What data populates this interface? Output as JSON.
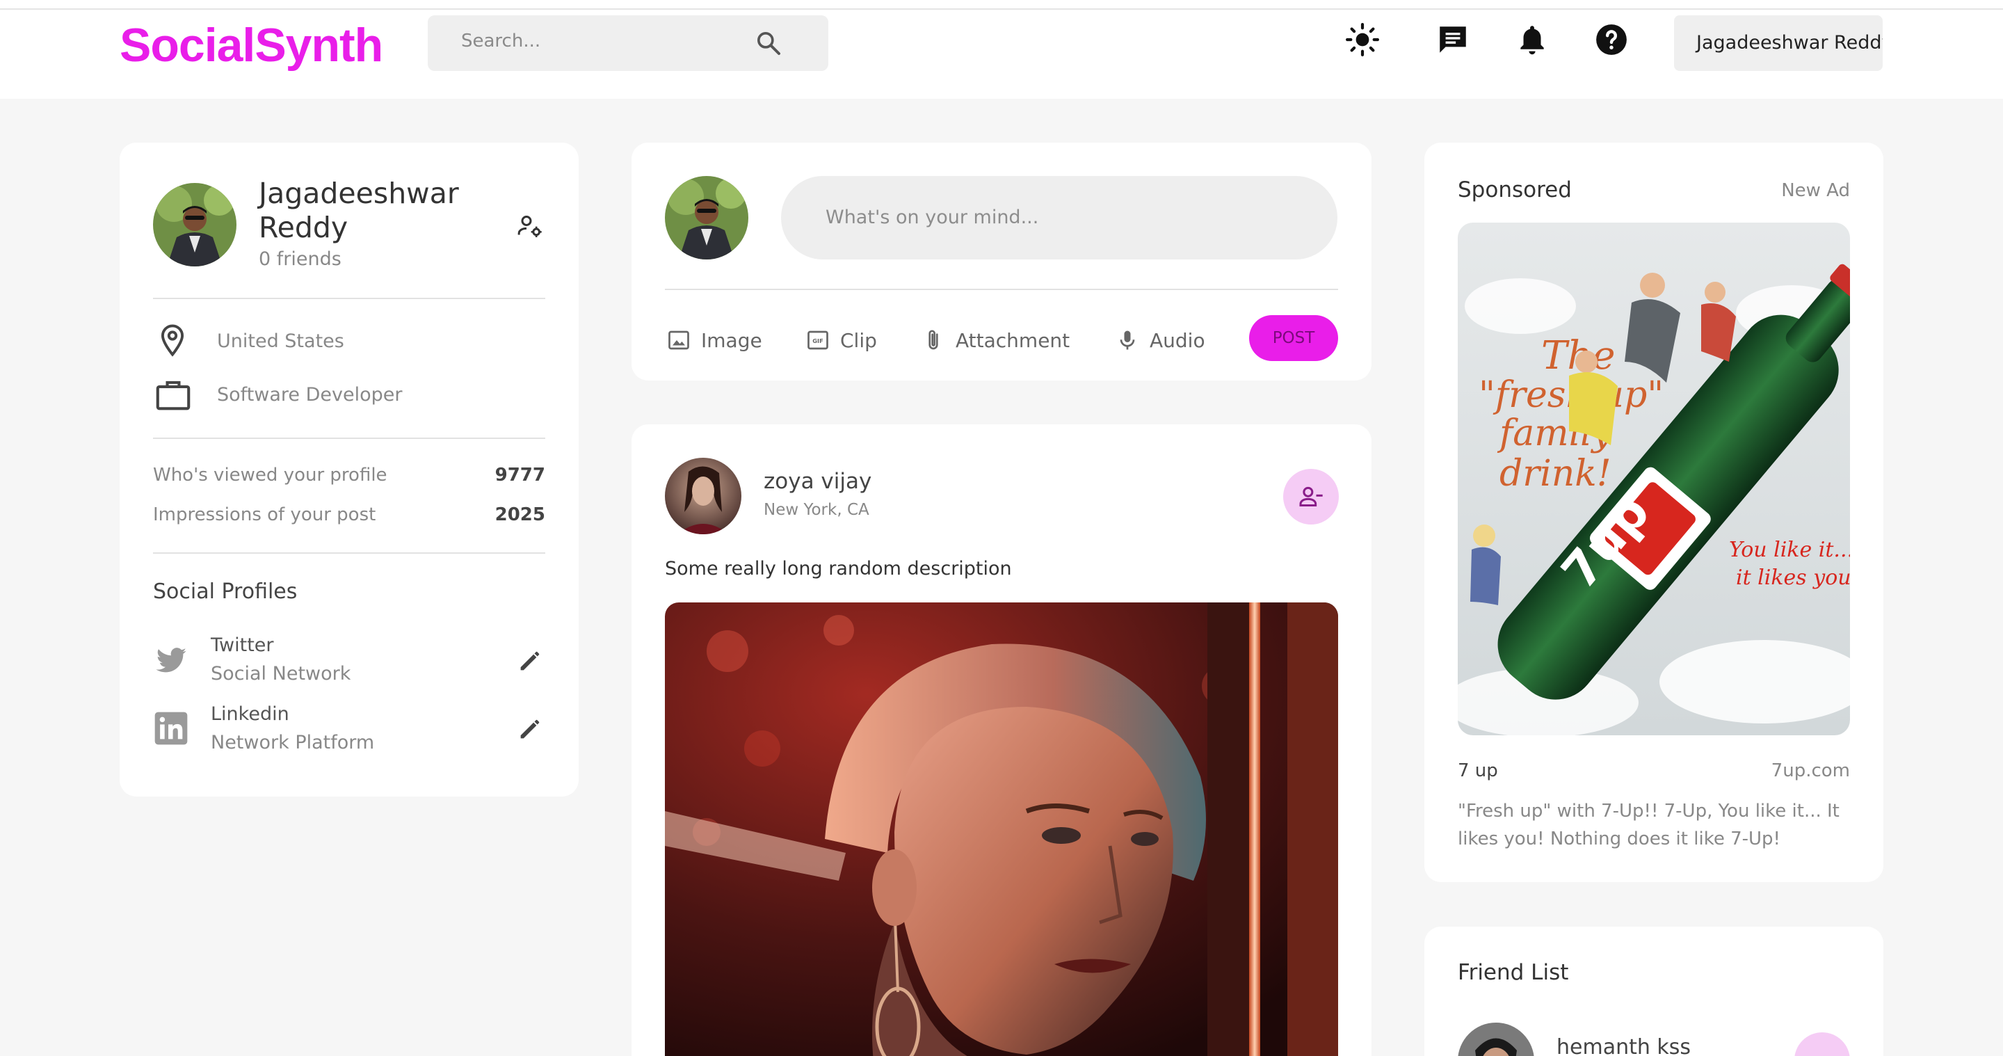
{
  "app": {
    "logo": "SocialSynth",
    "brand_color": "#e91ee9"
  },
  "search": {
    "placeholder": "Search..."
  },
  "header": {
    "icons": [
      "light-mode-icon",
      "messages-icon",
      "notifications-icon",
      "help-icon"
    ],
    "user_button": "Jagadeeshwar Reddy"
  },
  "profile": {
    "name_line1": "Jagadeeshwar",
    "name_line2": "Reddy",
    "friends": "0 friends",
    "location": "United States",
    "occupation": "Software Developer",
    "stats": [
      {
        "label": "Who's viewed your profile",
        "value": "9777"
      },
      {
        "label": "Impressions of your post",
        "value": "2025"
      }
    ],
    "social_title": "Social Profiles",
    "socials": [
      {
        "name": "Twitter",
        "type": "Social Network",
        "icon": "twitter-icon"
      },
      {
        "name": "Linkedin",
        "type": "Network Platform",
        "icon": "linkedin-icon"
      }
    ]
  },
  "composer": {
    "placeholder": "What's on your mind...",
    "tools": [
      {
        "label": "Image",
        "icon": "image-icon"
      },
      {
        "label": "Clip",
        "icon": "gif-icon"
      },
      {
        "label": "Attachment",
        "icon": "paperclip-icon"
      },
      {
        "label": "Audio",
        "icon": "microphone-icon"
      }
    ],
    "post_label": "POST"
  },
  "post": {
    "author": "zoya vijay",
    "location": "New York, CA",
    "description": "Some really long random description"
  },
  "sponsored": {
    "title": "Sponsored",
    "new_ad": "New Ad",
    "ad_name": "7 up",
    "ad_site": "7up.com",
    "ad_text_line1": "\"Fresh up\" with 7-Up!! 7-Up, You like it... It",
    "ad_text_line2": "likes you! Nothing does it like 7-Up!",
    "ad_image": {
      "headline_1": "The",
      "headline_2": "\"fresh up\"",
      "headline_3": "family",
      "headline_4": "drink!",
      "brand": "7up",
      "tagline_1": "You like it...",
      "tagline_2": "it likes you."
    }
  },
  "friends": {
    "title": "Friend List",
    "items": [
      {
        "name": "hemanth kss"
      }
    ]
  }
}
